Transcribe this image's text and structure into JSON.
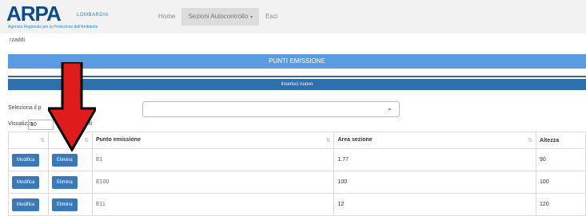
{
  "logo": {
    "mark": "ARPA",
    "sub": "LOMBARDIA",
    "caption": "Agenzia Regionale per la Protezione dell'Ambiente"
  },
  "nav": {
    "items": [
      {
        "label": "Home"
      },
      {
        "label": "Sezioni Autocontrollo"
      },
      {
        "label": "Esci"
      }
    ]
  },
  "user": "rzaddi",
  "page": {
    "title": "PUNTI EMISSIONE",
    "new_button": "Inserisci nuovo"
  },
  "select": {
    "label": "Seleziona il p",
    "value": ""
  },
  "length": {
    "prefix": "Visualizza",
    "value": "10",
    "suffix": "enti"
  },
  "table": {
    "headers": [
      "",
      "",
      "Punto emissione",
      "Area sezione",
      "Altezza"
    ],
    "rows": [
      {
        "edit": "Modifica",
        "delete": "Elimina",
        "punto": "E1",
        "area": "1.77",
        "altezza": "90"
      },
      {
        "edit": "Modifica",
        "delete": "Elimina",
        "punto": "E100",
        "area": "100",
        "altezza": "100"
      },
      {
        "edit": "Modifica",
        "delete": "Elimina",
        "punto": "E11",
        "area": "12",
        "altezza": "120"
      }
    ]
  },
  "colors": {
    "banner": "#5b9be0",
    "button": "#3a78b8",
    "arrow": "#e01b1b"
  }
}
